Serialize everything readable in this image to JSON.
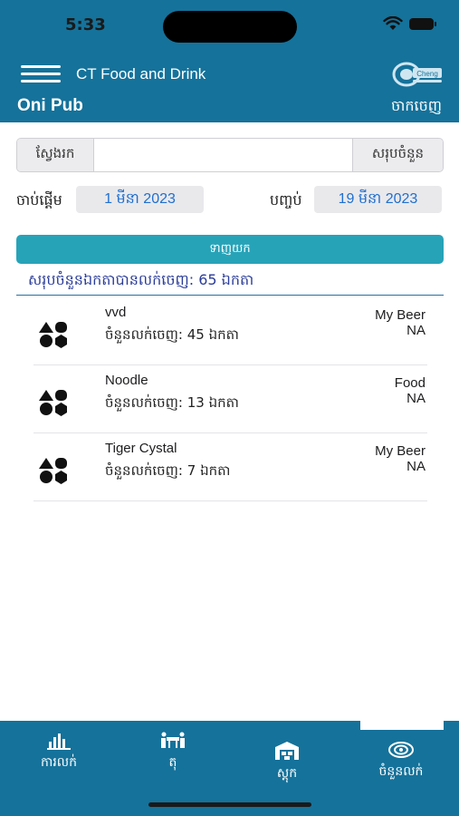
{
  "status_bar": {
    "time": "5:33"
  },
  "header": {
    "app_title": "CT Food and Drink",
    "shop_name": "Oni Pub",
    "logout_label": "ចាកចេញ",
    "logo_text": "Cheng"
  },
  "search": {
    "label": "ស្វែងរក",
    "value": "",
    "placeholder": "",
    "total_button": "សរុបចំនួន"
  },
  "date_filter": {
    "start_label": "ចាប់ផ្តើម",
    "start_value": "1 មីនា 2023",
    "end_label": "បញ្ចប់",
    "end_value": "19 មីនា 2023"
  },
  "fetch_button": "ទាញយក",
  "summary": "សរុបចំនួនឯកតាបានលក់ចេញ: 65 ឯកតា",
  "items": [
    {
      "name": "vvd",
      "qty": "ចំនួនលក់ចេញ: 45 ឯកតា",
      "category": "My Beer",
      "status": "NA"
    },
    {
      "name": "Noodle",
      "qty": "ចំនួនលក់ចេញ: 13 ឯកតា",
      "category": "Food",
      "status": "NA"
    },
    {
      "name": "Tiger Cystal",
      "qty": "ចំនួនលក់ចេញ: 7 ឯកតា",
      "category": "My Beer",
      "status": "NA"
    }
  ],
  "tabs": [
    {
      "label": "ការលក់",
      "icon": "bar-chart-icon"
    },
    {
      "label": "តុ",
      "icon": "tables-icon"
    },
    {
      "label": "ស្តុក",
      "icon": "warehouse-icon"
    },
    {
      "label": "ចំនួនលក់",
      "icon": "sales-count-icon",
      "active": true
    }
  ],
  "colors": {
    "primary": "#15729a",
    "accent_button": "#27a3b8",
    "summary_text": "#2b3d9a",
    "date_text": "#1f6fd1"
  }
}
